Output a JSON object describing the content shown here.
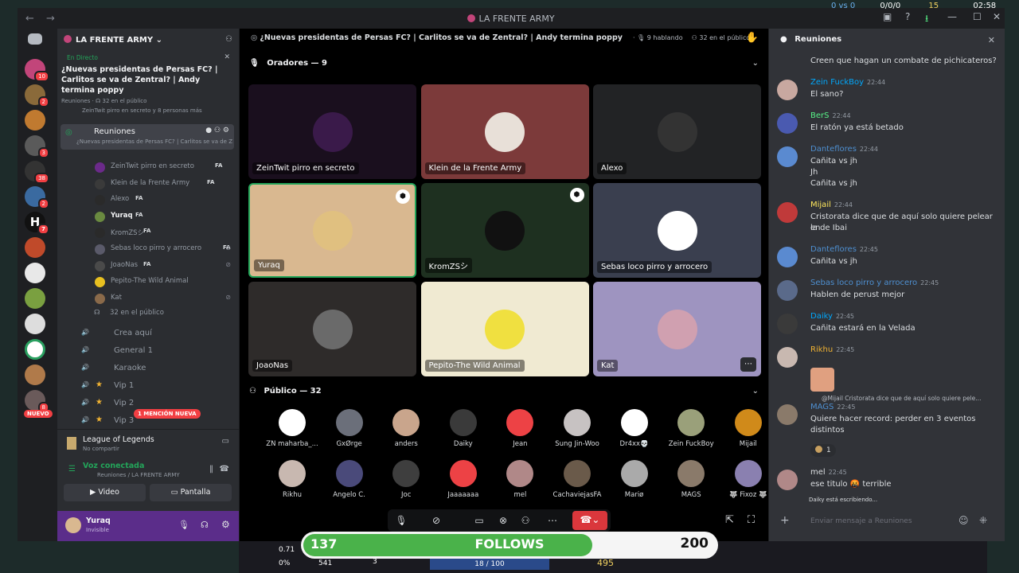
{
  "titlebar": {
    "title": "LA FRENTE ARMY",
    "back": "←",
    "fwd": "→"
  },
  "overlay": {
    "vs": "0 vs 0",
    "kda": "0/0/0",
    "gold": "15",
    "clock": "02:58",
    "left_stat1": "0.71",
    "left_stat2": "0%",
    "xp": "541",
    "level": "3",
    "mana": "18 / 100",
    "gold2": "495",
    "follows": {
      "left": "137",
      "label": "FOLLOWS",
      "right": "200"
    }
  },
  "server": {
    "name": "LA FRENTE ARMY"
  },
  "live": {
    "label": "En Directo",
    "title": "¿Nuevas presidentas de Persas FC? | Carlitos se va de Zentral? | Andy termina poppy",
    "sub_channel": "Reuniones",
    "sub_listeners": "32 en el público",
    "speakers_line": "ZeinTwit pirro en secreto y 8 personas más"
  },
  "channel": {
    "name": "Reuniones",
    "topic": "¿Nuevas presidentas de Persas FC? | Carlitos se va de Ze..."
  },
  "members": [
    {
      "name": "ZeinTwit pirro en secreto",
      "tag": "FA"
    },
    {
      "name": "Klein de la Frente Army",
      "tag": "FA"
    },
    {
      "name": "Alexo",
      "tag": "FA"
    },
    {
      "name": "Yuraq",
      "tag": "FA"
    },
    {
      "name": "KromZSシ",
      "tag": "FA"
    },
    {
      "name": "Sebas loco pirro y arrocero",
      "tag": "FA"
    },
    {
      "name": "JoaoNas",
      "tag": "FA"
    },
    {
      "name": "Pepito-The Wild Animal",
      "tag": ""
    },
    {
      "name": "Kat",
      "tag": ""
    }
  ],
  "audience_count": "32 en el público",
  "voice_channels": [
    "Crea aquí",
    "General 1",
    "Karaoke",
    "Vip 1",
    "Vip 2",
    "Vip 3"
  ],
  "mention_badge": "1 MENCIÓN NUEVA",
  "new_badge": "NUEVO",
  "activity": {
    "game": "League of Legends",
    "sub": "No compartir"
  },
  "voice": {
    "status": "Voz conectada",
    "path": "Reuniones / LA FRENTE ARMY",
    "video": "Video",
    "screen": "Pantalla"
  },
  "user": {
    "name": "Yuraq",
    "status": "Invisible"
  },
  "stage": {
    "title": "¿Nuevas presidentas de Persas FC? | Carlitos se va de Zentral? | Andy termina poppy",
    "speaking": "9 hablando",
    "audience": "32 en el público",
    "speakers_header": "Oradores — 9",
    "public_header": "Público — 32"
  },
  "tiles": [
    {
      "name": "ZeinTwit pirro en secreto",
      "bg": "#1a0f1e"
    },
    {
      "name": "Klein de la Frente Army",
      "bg": "#7c3a3a"
    },
    {
      "name": "Alexo",
      "bg": "#222325"
    },
    {
      "name": "Yuraq",
      "bg": "#d9b890"
    },
    {
      "name": "KromZSシ",
      "bg": "#1e3020"
    },
    {
      "name": "Sebas loco pirro y arrocero",
      "bg": "#3a3f4f"
    },
    {
      "name": "JoaoNas",
      "bg": "#2e2b2a"
    },
    {
      "name": "Pepito-The Wild Animal",
      "bg": "#f0ead2"
    },
    {
      "name": "Kat",
      "bg": "#9e94c0"
    }
  ],
  "public": [
    {
      "name": "ZN maharba_...",
      "color": "#ffffff"
    },
    {
      "name": "GxØrge",
      "color": "#6b6f7a"
    },
    {
      "name": "anders",
      "color": "#c9a58c"
    },
    {
      "name": "Daiky",
      "color": "#3a3a3a"
    },
    {
      "name": "Jean",
      "color": "#ed4245"
    },
    {
      "name": "Sung Jin-Woo",
      "color": "#c7c2c2"
    },
    {
      "name": "Dr4xx💀",
      "color": "#ffffff"
    },
    {
      "name": "Zein FuckBoy",
      "color": "#9aa07a"
    },
    {
      "name": "Mijail",
      "color": "#d08a1a"
    },
    {
      "name": "Rikhu",
      "color": "#c8b8b0"
    },
    {
      "name": "Angelo C.",
      "color": "#4a4a7a"
    },
    {
      "name": "Joc",
      "color": "#3e3e3e"
    },
    {
      "name": "Jaaaaaaa",
      "color": "#ed4245"
    },
    {
      "name": "mel",
      "color": "#b08888"
    },
    {
      "name": "CachaviejasFA",
      "color": "#6a5a4a"
    },
    {
      "name": "Mariø",
      "color": "#aaaaaa"
    },
    {
      "name": "MAGS",
      "color": "#8a7a6a"
    },
    {
      "name": "🐺 Fixoz 🐺",
      "color": "#8a80b0"
    }
  ],
  "chat": {
    "header": "Reuniones",
    "messages": [
      {
        "user": "",
        "time": "",
        "color": "#dbdee1",
        "lines": [
          "Creen que hagan un combate de pichicateros?"
        ]
      },
      {
        "user": "Zein FuckBoy",
        "time": "22:44",
        "color": "#00a8fc",
        "lines": [
          "El sano?"
        ]
      },
      {
        "user": "BerS",
        "time": "22:44",
        "color": "#57f287",
        "lines": [
          "El ratón ya está betado"
        ]
      },
      {
        "user": "Danteflores",
        "time": "22:44",
        "color": "#4e8fd0",
        "lines": [
          "Cañita vs jh",
          "Jh",
          "Cañita vs jh"
        ]
      },
      {
        "user": "Mijail",
        "time": "22:44",
        "color": "#fee75c",
        "lines": [
          "Cristorata dice que de aquí solo quiere pelear en",
          "la de Ibai"
        ]
      },
      {
        "user": "Danteflores",
        "time": "22:45",
        "color": "#4e8fd0",
        "lines": [
          "Cañita vs jh"
        ]
      },
      {
        "user": "Sebas loco pirro y arrocero",
        "time": "22:45",
        "color": "#4e8fd0",
        "lines": [
          "Hablen de perust mejor"
        ]
      },
      {
        "user": "Daiky",
        "time": "22:45",
        "color": "#00a8fc",
        "lines": [
          "Cañita estará en la Velada"
        ]
      },
      {
        "user": "Rikhu",
        "time": "22:45",
        "color": "#f0b232",
        "lines": [
          ""
        ]
      },
      {
        "user": "MAGS",
        "time": "22:45",
        "color": "#4e8fd0",
        "lines": [
          "Quiere hacer record: perder en 3 eventos",
          "distintos"
        ]
      },
      {
        "user": "mel",
        "time": "22:45",
        "color": "#dbdee1",
        "lines": [
          "ese titulo 🤬 terrible"
        ]
      }
    ],
    "reply": "@Mijail Cristorata dice que de aquí solo quiere pele...",
    "reaction_count": "1",
    "typing": "Daiky está escribiendo...",
    "placeholder": "Enviar mensaje a",
    "placeholder_ch": "Reuniones"
  }
}
